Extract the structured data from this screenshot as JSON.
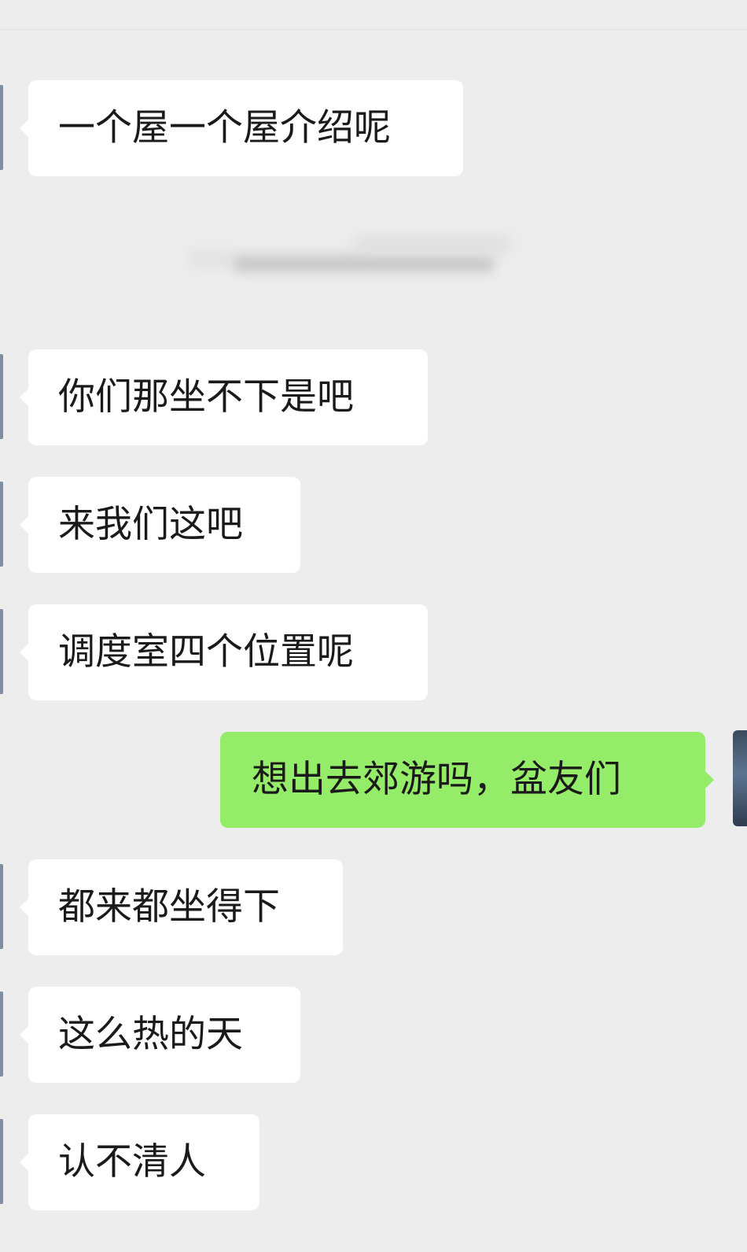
{
  "chat": {
    "messages": [
      {
        "direction": "incoming",
        "text": "一个屋一个屋介绍呢"
      },
      {
        "direction": "incoming",
        "text": "你们那坐不下是吧"
      },
      {
        "direction": "incoming",
        "text": "来我们这吧"
      },
      {
        "direction": "incoming",
        "text": "调度室四个位置呢"
      },
      {
        "direction": "outgoing",
        "text": "想出去郊游吗，盆友们"
      },
      {
        "direction": "incoming",
        "text": "都来都坐得下"
      },
      {
        "direction": "incoming",
        "text": "这么热的天"
      },
      {
        "direction": "incoming",
        "text": "认不清人"
      }
    ]
  },
  "colors": {
    "background": "#ededed",
    "incoming_bubble": "#ffffff",
    "outgoing_bubble": "#95ec69",
    "text": "#1a1a1a"
  }
}
